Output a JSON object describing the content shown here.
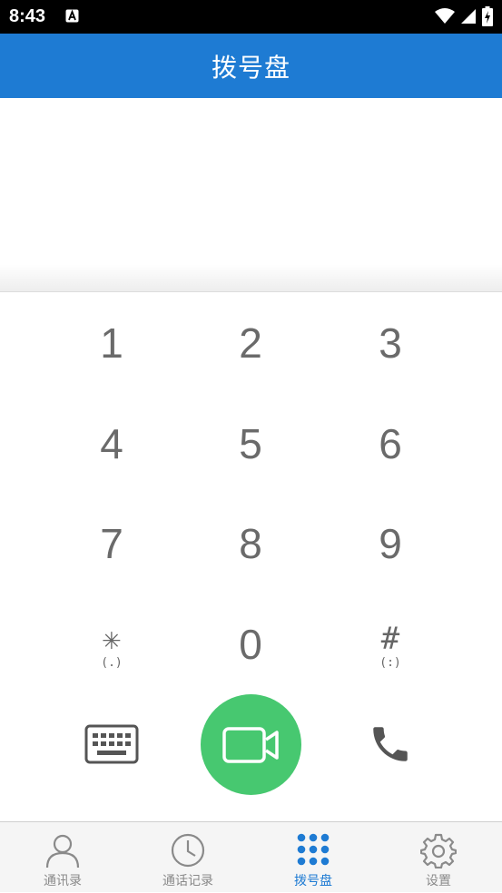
{
  "status_bar": {
    "time": "8:43",
    "notification_icon": "a-letter-icon",
    "icons": [
      "wifi-icon",
      "signal-icon",
      "battery-charging-icon"
    ]
  },
  "app_bar": {
    "title": "拨号盘"
  },
  "display": {
    "number": ""
  },
  "keypad": {
    "keys": [
      {
        "main": "1",
        "sub": ""
      },
      {
        "main": "2",
        "sub": ""
      },
      {
        "main": "3",
        "sub": ""
      },
      {
        "main": "4",
        "sub": ""
      },
      {
        "main": "5",
        "sub": ""
      },
      {
        "main": "6",
        "sub": ""
      },
      {
        "main": "7",
        "sub": ""
      },
      {
        "main": "8",
        "sub": ""
      },
      {
        "main": "9",
        "sub": ""
      },
      {
        "main": "✳",
        "sub": "(.)"
      },
      {
        "main": "0",
        "sub": ""
      },
      {
        "main": "#",
        "sub": "(:)"
      }
    ]
  },
  "actions": {
    "left_icon": "keyboard-icon",
    "center_icon": "video-call-icon",
    "right_icon": "phone-icon",
    "center_color": "#47c870"
  },
  "bottom_nav": {
    "items": [
      {
        "label": "通讯录",
        "icon": "contacts-icon",
        "active": false
      },
      {
        "label": "通话记录",
        "icon": "clock-icon",
        "active": false
      },
      {
        "label": "拨号盘",
        "icon": "dialpad-icon",
        "active": true
      },
      {
        "label": "设置",
        "icon": "gear-icon",
        "active": false
      }
    ]
  },
  "colors": {
    "primary": "#1e7bd3",
    "inactive": "#8a8a8a",
    "status_bar": "#000000"
  }
}
